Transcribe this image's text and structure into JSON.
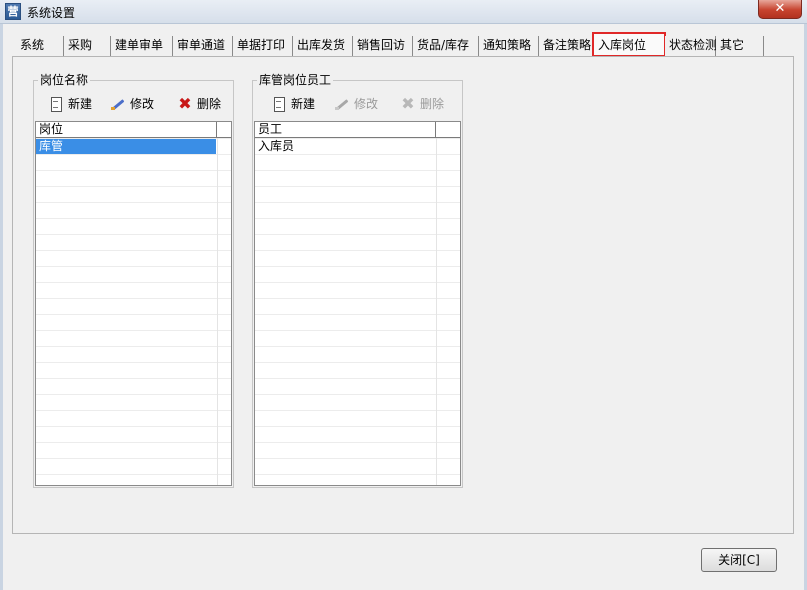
{
  "window": {
    "title": "系统设置",
    "close_glyph": "✕"
  },
  "tabs": [
    {
      "label": "系统"
    },
    {
      "label": "采购"
    },
    {
      "label": "建单审单"
    },
    {
      "label": "审单通道"
    },
    {
      "label": "单据打印"
    },
    {
      "label": "出库发货"
    },
    {
      "label": "销售回访"
    },
    {
      "label": "货品/库存"
    },
    {
      "label": "通知策略"
    },
    {
      "label": "备注策略"
    },
    {
      "label": "入库岗位",
      "active": true
    },
    {
      "label": "状态检测"
    },
    {
      "label": "其它"
    }
  ],
  "left_group": {
    "title": "岗位名称",
    "new_label": "新建",
    "edit_label": "修改",
    "delete_label": "删除",
    "column_header": "岗位",
    "rows": [
      "库管"
    ],
    "selected_row": 0
  },
  "right_group": {
    "title": "库管岗位员工",
    "new_label": "新建",
    "edit_label": "修改",
    "delete_label": "删除",
    "edit_enabled": false,
    "delete_enabled": false,
    "column_header": "员工",
    "rows": [
      "入库员"
    ]
  },
  "footer": {
    "close_label": "关闭[C]"
  },
  "colors": {
    "selection": "#3a8ee6",
    "highlight_outline": "#e02828",
    "delete_icon": "#c81818"
  }
}
